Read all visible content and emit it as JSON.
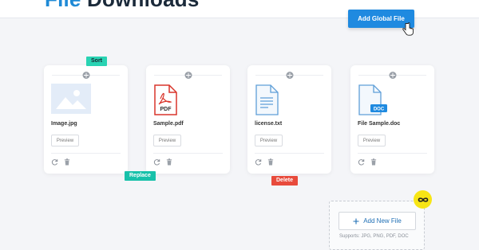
{
  "header": {
    "title_accent": "File",
    "title_main": "Downloads",
    "add_global_label": "Add Global File"
  },
  "tags": {
    "sort": "Sort",
    "replace": "Replace",
    "delete": "Delete"
  },
  "files": [
    {
      "name": "Image.jpg",
      "preview_label": "Preview",
      "icon": "image-icon"
    },
    {
      "name": "Sample.pdf",
      "preview_label": "Preview",
      "icon": "pdf-file-icon",
      "icon_label": "PDF"
    },
    {
      "name": "license.txt",
      "preview_label": "Preview",
      "icon": "text-file-icon"
    },
    {
      "name": "File Sample.doc",
      "preview_label": "Preview",
      "icon": "doc-file-icon",
      "icon_label": "DOC"
    }
  ],
  "new_file": {
    "button_label": "Add New File",
    "supports_text": "Supports: JPG, PNG, PDF, DOC"
  },
  "colors": {
    "primary": "#1f8ae0",
    "sort_tag": "#29d3b3",
    "replace_tag": "#18c1aa",
    "delete_tag": "#e84b3c",
    "badge": "#f7e515",
    "pdf_red": "#d9352b"
  }
}
